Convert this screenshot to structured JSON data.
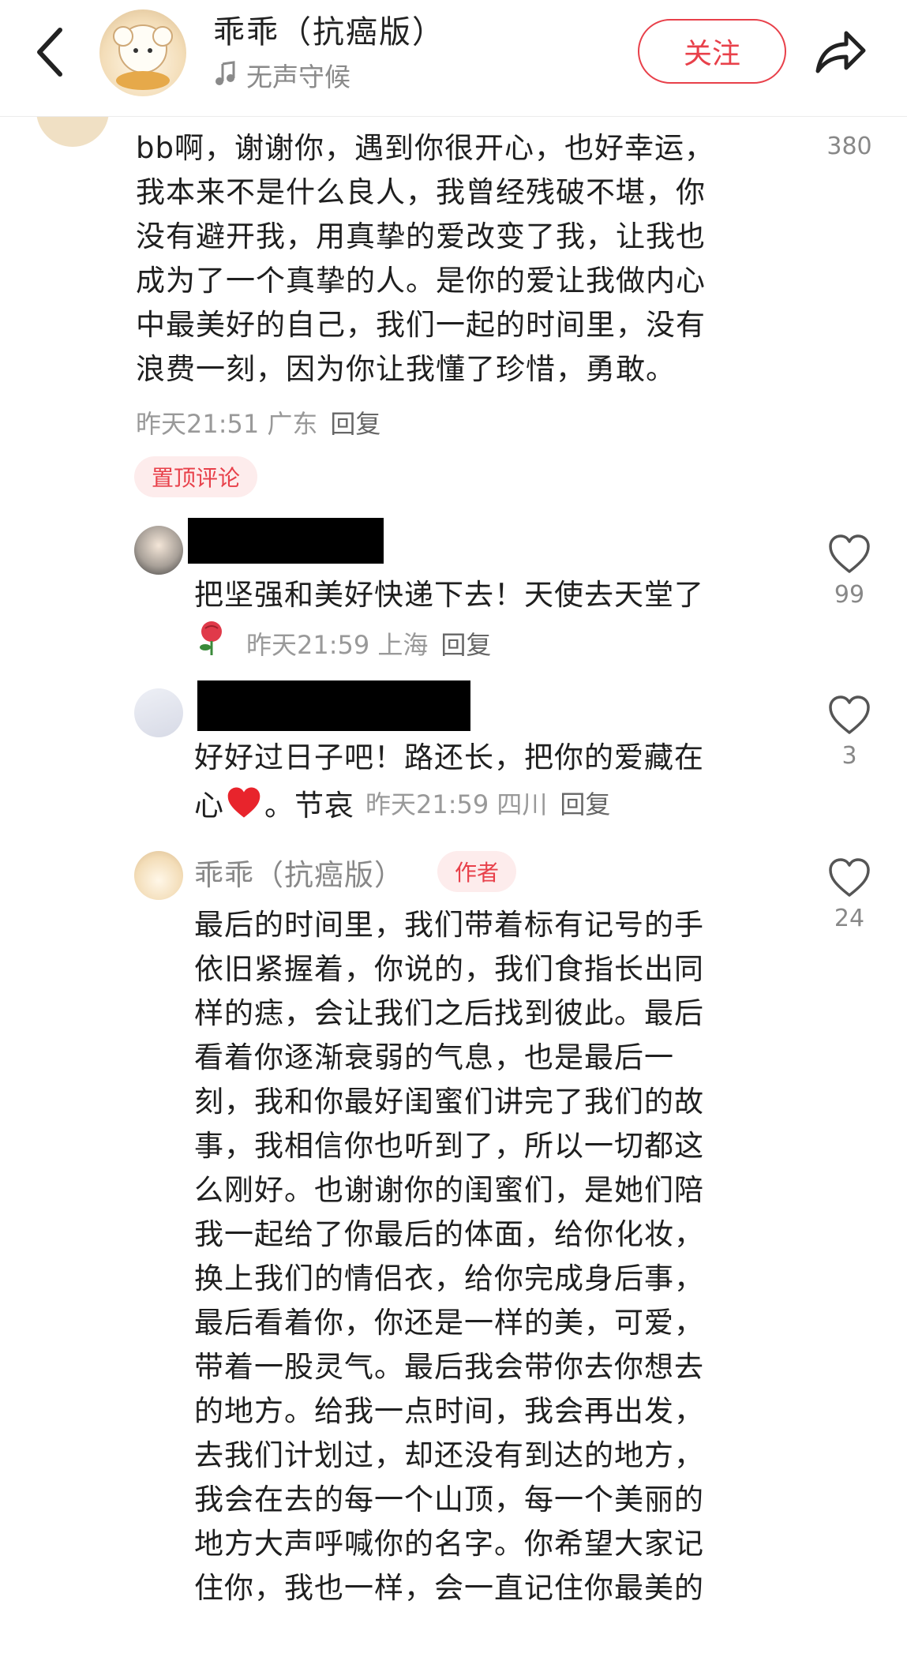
{
  "header": {
    "author_name": "乖乖（抗癌版）",
    "music_label": "无声守候",
    "follow_label": "关注"
  },
  "main_comment": {
    "lines": [
      "bb啊，谢谢你，遇到你很开心，也好幸运，",
      "我本来不是什么良人，我曾经残破不堪，你",
      "没有避开我，用真挚的爱改变了我，让我也",
      "成为了一个真挚的人。是你的爱让我做内心",
      "中最美好的自己，我们一起的时间里，没有",
      "浪费一刻，因为你让我懂了珍惜，勇敢。"
    ],
    "meta": "昨天21:51 广东",
    "reply_label": "回复",
    "likes": "380",
    "pinned_badge": "置顶评论"
  },
  "replies": [
    {
      "text_lines": [
        "把坚强和美好快递下去！天使去天堂了"
      ],
      "meta": "昨天21:59 上海",
      "reply_label": "回复",
      "likes": "99"
    },
    {
      "text_lines": [
        "好好过日子吧！路还长，把你的爱藏在"
      ],
      "tail_a": "心",
      "tail_b": "。节哀",
      "meta": "昨天21:59 四川",
      "reply_label": "回复",
      "likes": "3"
    },
    {
      "author": "乖乖（抗癌版）",
      "author_badge": "作者",
      "text_lines": [
        "最后的时间里，我们带着标有记号的手",
        "依旧紧握着，你说的，我们食指长出同",
        "样的痣，会让我们之后找到彼此。最后",
        "看着你逐渐衰弱的气息，也是最后一",
        "刻，我和你最好闺蜜们讲完了我们的故",
        "事，我相信你也听到了，所以一切都这",
        "么刚好。也谢谢你的闺蜜们，是她们陪",
        "我一起给了你最后的体面，给你化妆，",
        "换上我们的情侣衣，给你完成身后事，",
        "最后看着你，你还是一样的美，可爱，",
        "带着一股灵气。最后我会带你去你想去",
        "的地方。给我一点时间，我会再出发，",
        "去我们计划过，却还没有到达的地方，",
        "我会在去的每一个山顶，每一个美丽的",
        "地方大声呼喊你的名字。你希望大家记",
        "住你，我也一样，会一直记住你最美的"
      ],
      "likes": "24"
    }
  ],
  "colors": {
    "accent": "#e8404a",
    "meta": "#999999",
    "badge_bg": "#fdecec"
  }
}
